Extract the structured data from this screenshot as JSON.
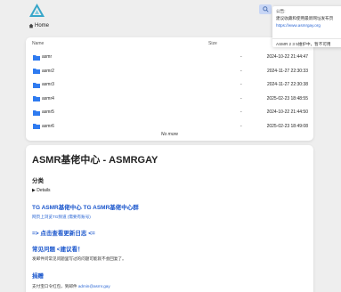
{
  "header": {
    "breadcrumb_label": "Home"
  },
  "file_list": {
    "columns": {
      "name": "Name",
      "size": "Size",
      "modified": ""
    },
    "rows": [
      {
        "name": "asmr",
        "size": "-",
        "modified": "2024-10-22 21:44:47"
      },
      {
        "name": "asmr2",
        "size": "-",
        "modified": "2024-11-27 22:30:33"
      },
      {
        "name": "asmr3",
        "size": "-",
        "modified": "2024-11-27 22:30:38"
      },
      {
        "name": "asmr4",
        "size": "-",
        "modified": "2025-02-23 18:48:55"
      },
      {
        "name": "asmr5",
        "size": "-",
        "modified": "2024-10-22 21:44:50"
      },
      {
        "name": "asmr6",
        "size": "-",
        "modified": "2025-02-23 18:49:08"
      }
    ],
    "no_more": "No more"
  },
  "readme": {
    "title": "ASMR基佬中心 - ASMRGAY",
    "category_heading": "分类",
    "details_label": "▶ Details",
    "tg_heading": "TG ASMR基佬中心 TG ASMR基佬中心群",
    "tg_link": "网页上浏览TG频道 (需要有账号)",
    "changelog_heading": "=> 点击查看更新日志 <=",
    "faq_heading": "常见问题 <建议看！",
    "faq_text": "发邮件问常见问题里写过的问题可能就不会回复了。",
    "donate_heading": "捐赠",
    "donate_text": "支付宝口令红包，到邮件",
    "donate_email": "admin@asmr.gay"
  },
  "notice": {
    "title": "公告:",
    "line1": "建议收藏和使用最新网址发布页",
    "url": "https://www.asmrgay.org",
    "line2": "ASMR 2 3 5维护中，暂不可用"
  },
  "colors": {
    "accent_blue": "#1a56cc",
    "folder_blue": "#2f7bf0",
    "logo_teal": "#37a6c9"
  }
}
